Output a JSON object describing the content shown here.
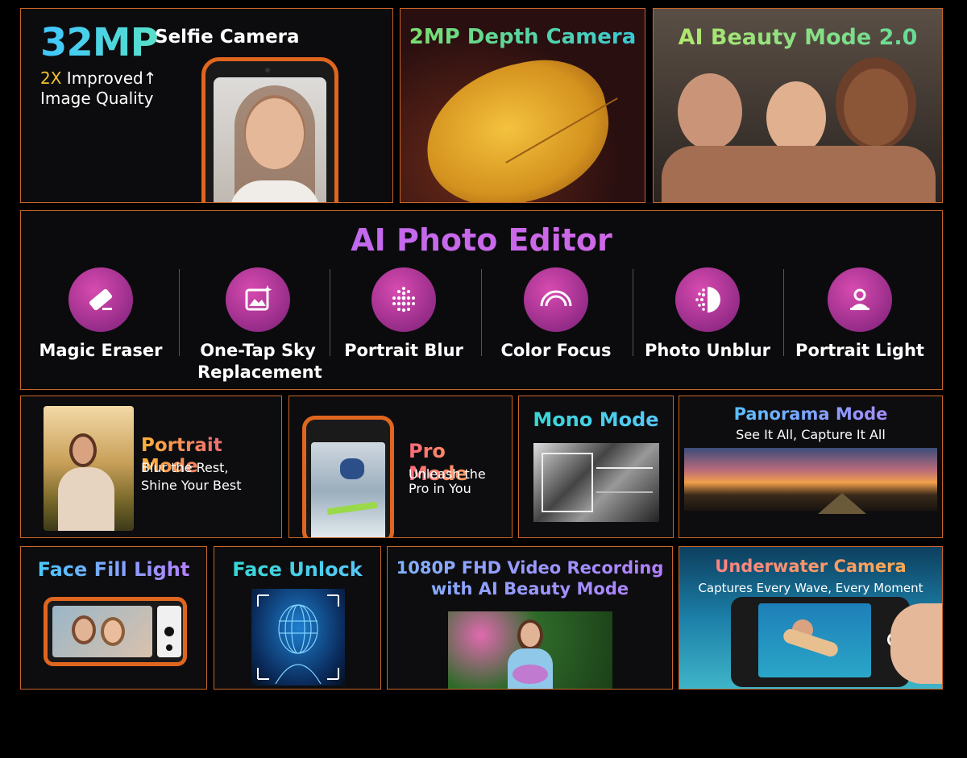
{
  "selfie": {
    "big": "32MP",
    "title": "Selfie Camera",
    "accent": "2X",
    "line1": " Improved↑",
    "line2": "Image Quality"
  },
  "depth": {
    "title": "2MP Depth Camera"
  },
  "beauty": {
    "title": "AI Beauty Mode 2.0"
  },
  "editor": {
    "title": "AI Photo Editor",
    "features": [
      {
        "label": "Magic Eraser",
        "icon": "eraser-icon"
      },
      {
        "label": "One-Tap Sky Replacement",
        "icon": "sky-image-icon"
      },
      {
        "label": "Portrait Blur",
        "icon": "dots-blur-icon"
      },
      {
        "label": "Color Focus",
        "icon": "rainbow-arc-icon"
      },
      {
        "label": "Photo Unblur",
        "icon": "half-circle-dots-icon"
      },
      {
        "label": "Portrait Light",
        "icon": "person-light-icon"
      }
    ]
  },
  "portrait": {
    "title": "Portrait Mode",
    "sub1": "Blur the Rest,",
    "sub2": "Shine Your Best"
  },
  "pro": {
    "title": "Pro Mode",
    "sub1": "Unleash the",
    "sub2": "Pro in You"
  },
  "mono": {
    "title": "Mono Mode"
  },
  "panorama": {
    "title": "Panorama Mode",
    "sub": "See It All, Capture It All"
  },
  "fill": {
    "title": "Face Fill Light"
  },
  "unlock": {
    "title": "Face Unlock"
  },
  "video": {
    "line1": "1080P FHD Video Recording",
    "line2": "with AI Beauty Mode"
  },
  "underwater": {
    "title": "Underwater Camera",
    "sub": "Captures Every Wave, Every Moment"
  },
  "colors": {
    "border": "#c9652b",
    "accent_orange": "#e0661f",
    "icon_purple": "#b03c9e"
  }
}
